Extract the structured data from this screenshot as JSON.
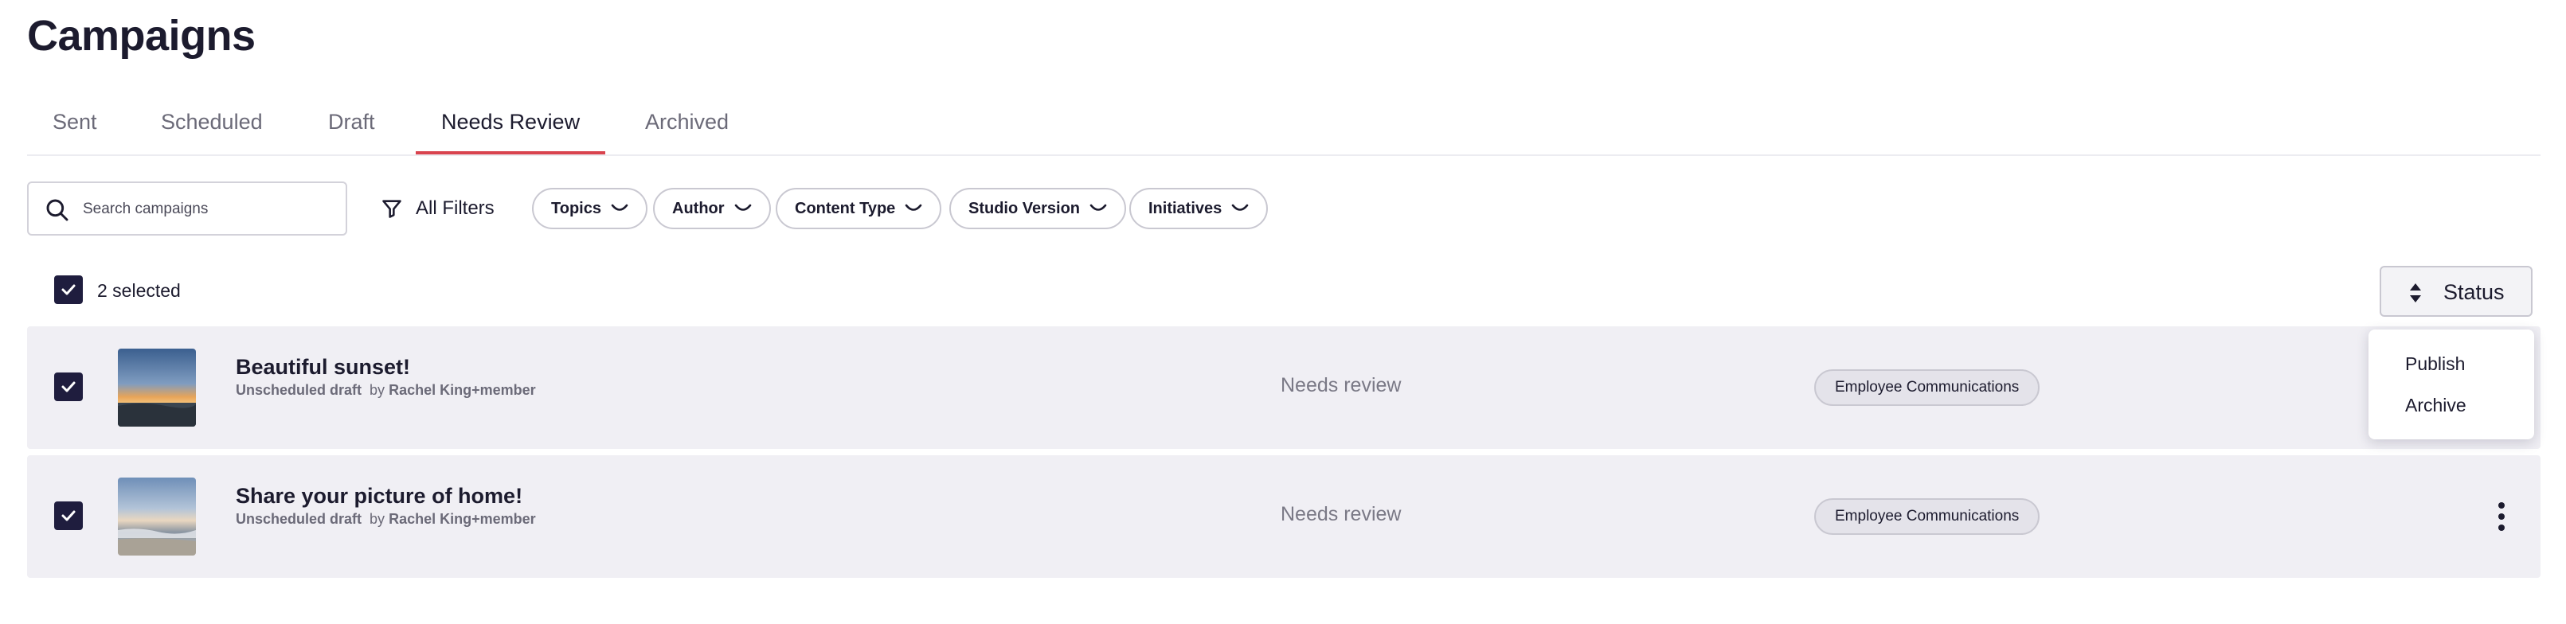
{
  "page": {
    "title": "Campaigns"
  },
  "tabs": [
    {
      "label": "Sent"
    },
    {
      "label": "Scheduled"
    },
    {
      "label": "Draft"
    },
    {
      "label": "Needs Review",
      "active": true
    },
    {
      "label": "Archived"
    }
  ],
  "toolbar": {
    "search_placeholder": "Search campaigns",
    "search_value": "",
    "all_filters_label": "All Filters",
    "filter_chips": [
      {
        "label": "Topics"
      },
      {
        "label": "Author"
      },
      {
        "label": "Content Type"
      },
      {
        "label": "Studio Version"
      },
      {
        "label": "Initiatives"
      }
    ]
  },
  "selection": {
    "checked": true,
    "label": "2 selected"
  },
  "sort": {
    "label": "Status",
    "icon": "sort-icon"
  },
  "status_menu": {
    "items": [
      {
        "label": "Publish"
      },
      {
        "label": "Archive"
      }
    ]
  },
  "rows": [
    {
      "checked": true,
      "title": "Beautiful sunset!",
      "draft_state": "Unscheduled draft",
      "by": "by",
      "author": "Rachel King+member",
      "status": "Needs review",
      "tag": "Employee Communications"
    },
    {
      "checked": true,
      "title": "Share your picture of home!",
      "draft_state": "Unscheduled draft",
      "by": "by",
      "author": "Rachel King+member",
      "status": "Needs review",
      "tag": "Employee Communications"
    }
  ],
  "colors": {
    "accent_underline": "#d9434e",
    "checkbox": "#1f1d3e",
    "row_background": "#f0eff4",
    "text": "#1c1b2e"
  }
}
